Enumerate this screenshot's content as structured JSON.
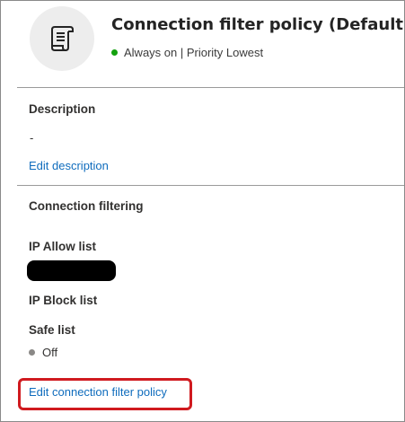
{
  "header": {
    "title": "Connection filter policy (Default)",
    "status_text": "Always on | Priority Lowest",
    "status_color": "#13a10e",
    "avatar_icon": "scroll-policy-icon"
  },
  "description": {
    "heading": "Description",
    "value": "-",
    "edit_link": "Edit description"
  },
  "connection_filtering": {
    "heading": "Connection filtering",
    "ip_allow_label": "IP Allow list",
    "ip_block_label": "IP Block list",
    "safe_list_label": "Safe list",
    "safe_list_value": "Off",
    "edit_link": "Edit connection filter policy"
  },
  "colors": {
    "link": "#0f6cbd",
    "highlight": "#d01a1f"
  }
}
